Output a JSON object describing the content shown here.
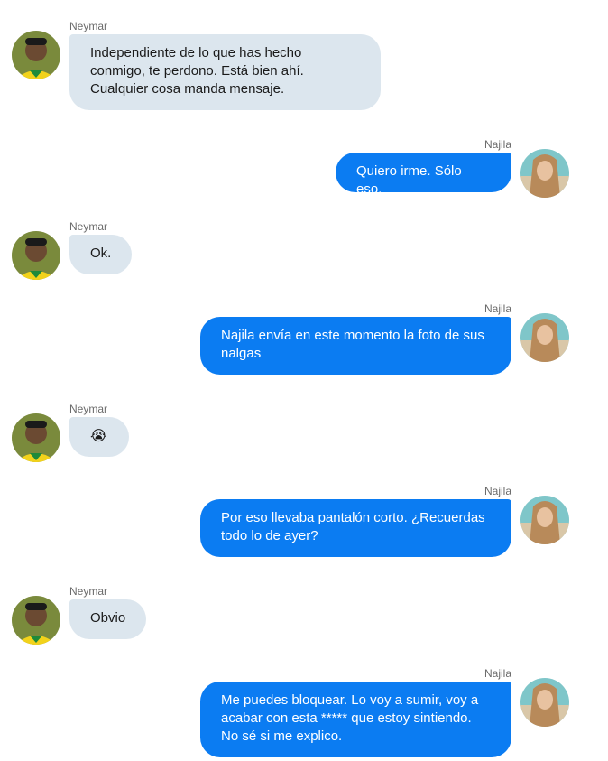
{
  "participants": {
    "left": "Neymar",
    "right": "Najila"
  },
  "messages": [
    {
      "sender": "Neymar",
      "side": "in",
      "text": "Independiente de lo que has hecho conmigo, te perdono. Está bien ahí. Cualquier cosa manda mensaje."
    },
    {
      "sender": "Najila",
      "side": "out",
      "text": "Quiero irme. Sólo eso."
    },
    {
      "sender": "Neymar",
      "side": "in",
      "text": "Ok."
    },
    {
      "sender": "Najila",
      "side": "out",
      "text": "Najila envía en este momento la foto de sus nalgas"
    },
    {
      "sender": "Neymar",
      "side": "in",
      "text": "😭",
      "icon": "crying-emoji-icon"
    },
    {
      "sender": "Najila",
      "side": "out",
      "text": "Por eso llevaba pantalón corto. ¿Recuerdas todo lo de ayer?"
    },
    {
      "sender": "Neymar",
      "side": "in",
      "text": "Obvio"
    },
    {
      "sender": "Najila",
      "side": "out",
      "text": "Me puedes bloquear. Lo voy a sumir, voy a acabar con esta ***** que estoy sintiendo. No sé si me explico."
    }
  ],
  "colors": {
    "incoming_bubble": "#dce6ee",
    "outgoing_bubble": "#0b7cf2",
    "outgoing_text": "#ffffff",
    "sender_label": "#6b6b6b"
  }
}
